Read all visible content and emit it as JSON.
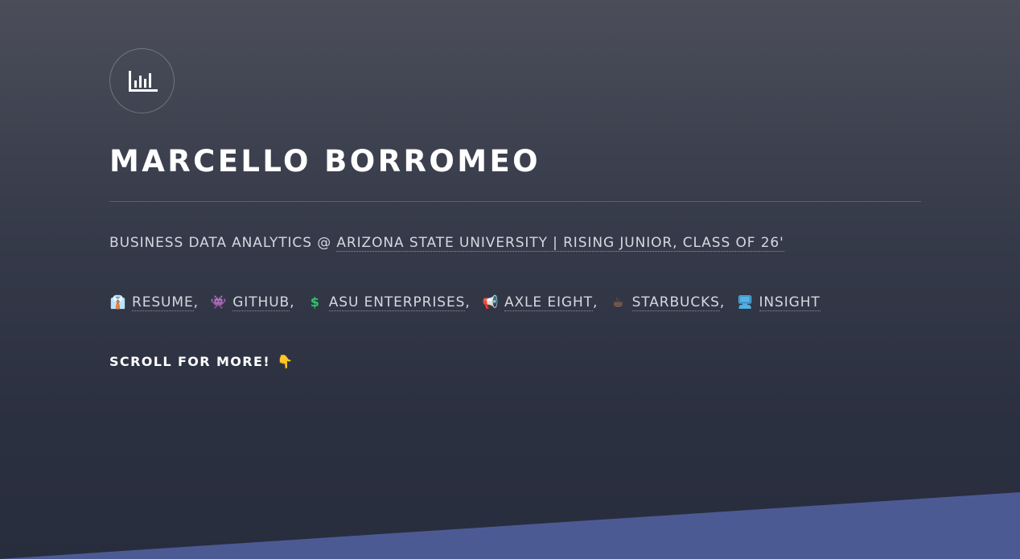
{
  "colors": {
    "accent_wedge": "#4c5a94",
    "background_top": "#4b4d59",
    "background_bottom": "#282d3d"
  },
  "header": {
    "logo_icon": "bar-chart-icon",
    "title": "MARCELLO BORROMEO",
    "tagline_prefix": "BUSINESS DATA ANALYTICS @ ",
    "tagline_link": "ARIZONA STATE UNIVERSITY | RISING JUNIOR, CLASS OF 26'"
  },
  "links": [
    {
      "icon": "necktie-emoji",
      "emoji": "👔",
      "label": "RESUME"
    },
    {
      "icon": "space-invader-emoji",
      "emoji": "👾",
      "label": "GITHUB"
    },
    {
      "icon": "dollar-sign-emoji",
      "emoji": "$",
      "label": "ASU ENTERPRISES"
    },
    {
      "icon": "megaphone-emoji",
      "emoji": "📢",
      "label": "AXLE EIGHT"
    },
    {
      "icon": "coffee-emoji",
      "emoji": "☕",
      "label": "STARBUCKS"
    },
    {
      "icon": "computer-emoji",
      "emoji": "🖥",
      "label": "INSIGHT"
    }
  ],
  "separator": ",",
  "scroll_prompt": {
    "label": "SCROLL FOR MORE!",
    "icon": "pointing-down-hand-emoji",
    "emoji": "👇"
  }
}
